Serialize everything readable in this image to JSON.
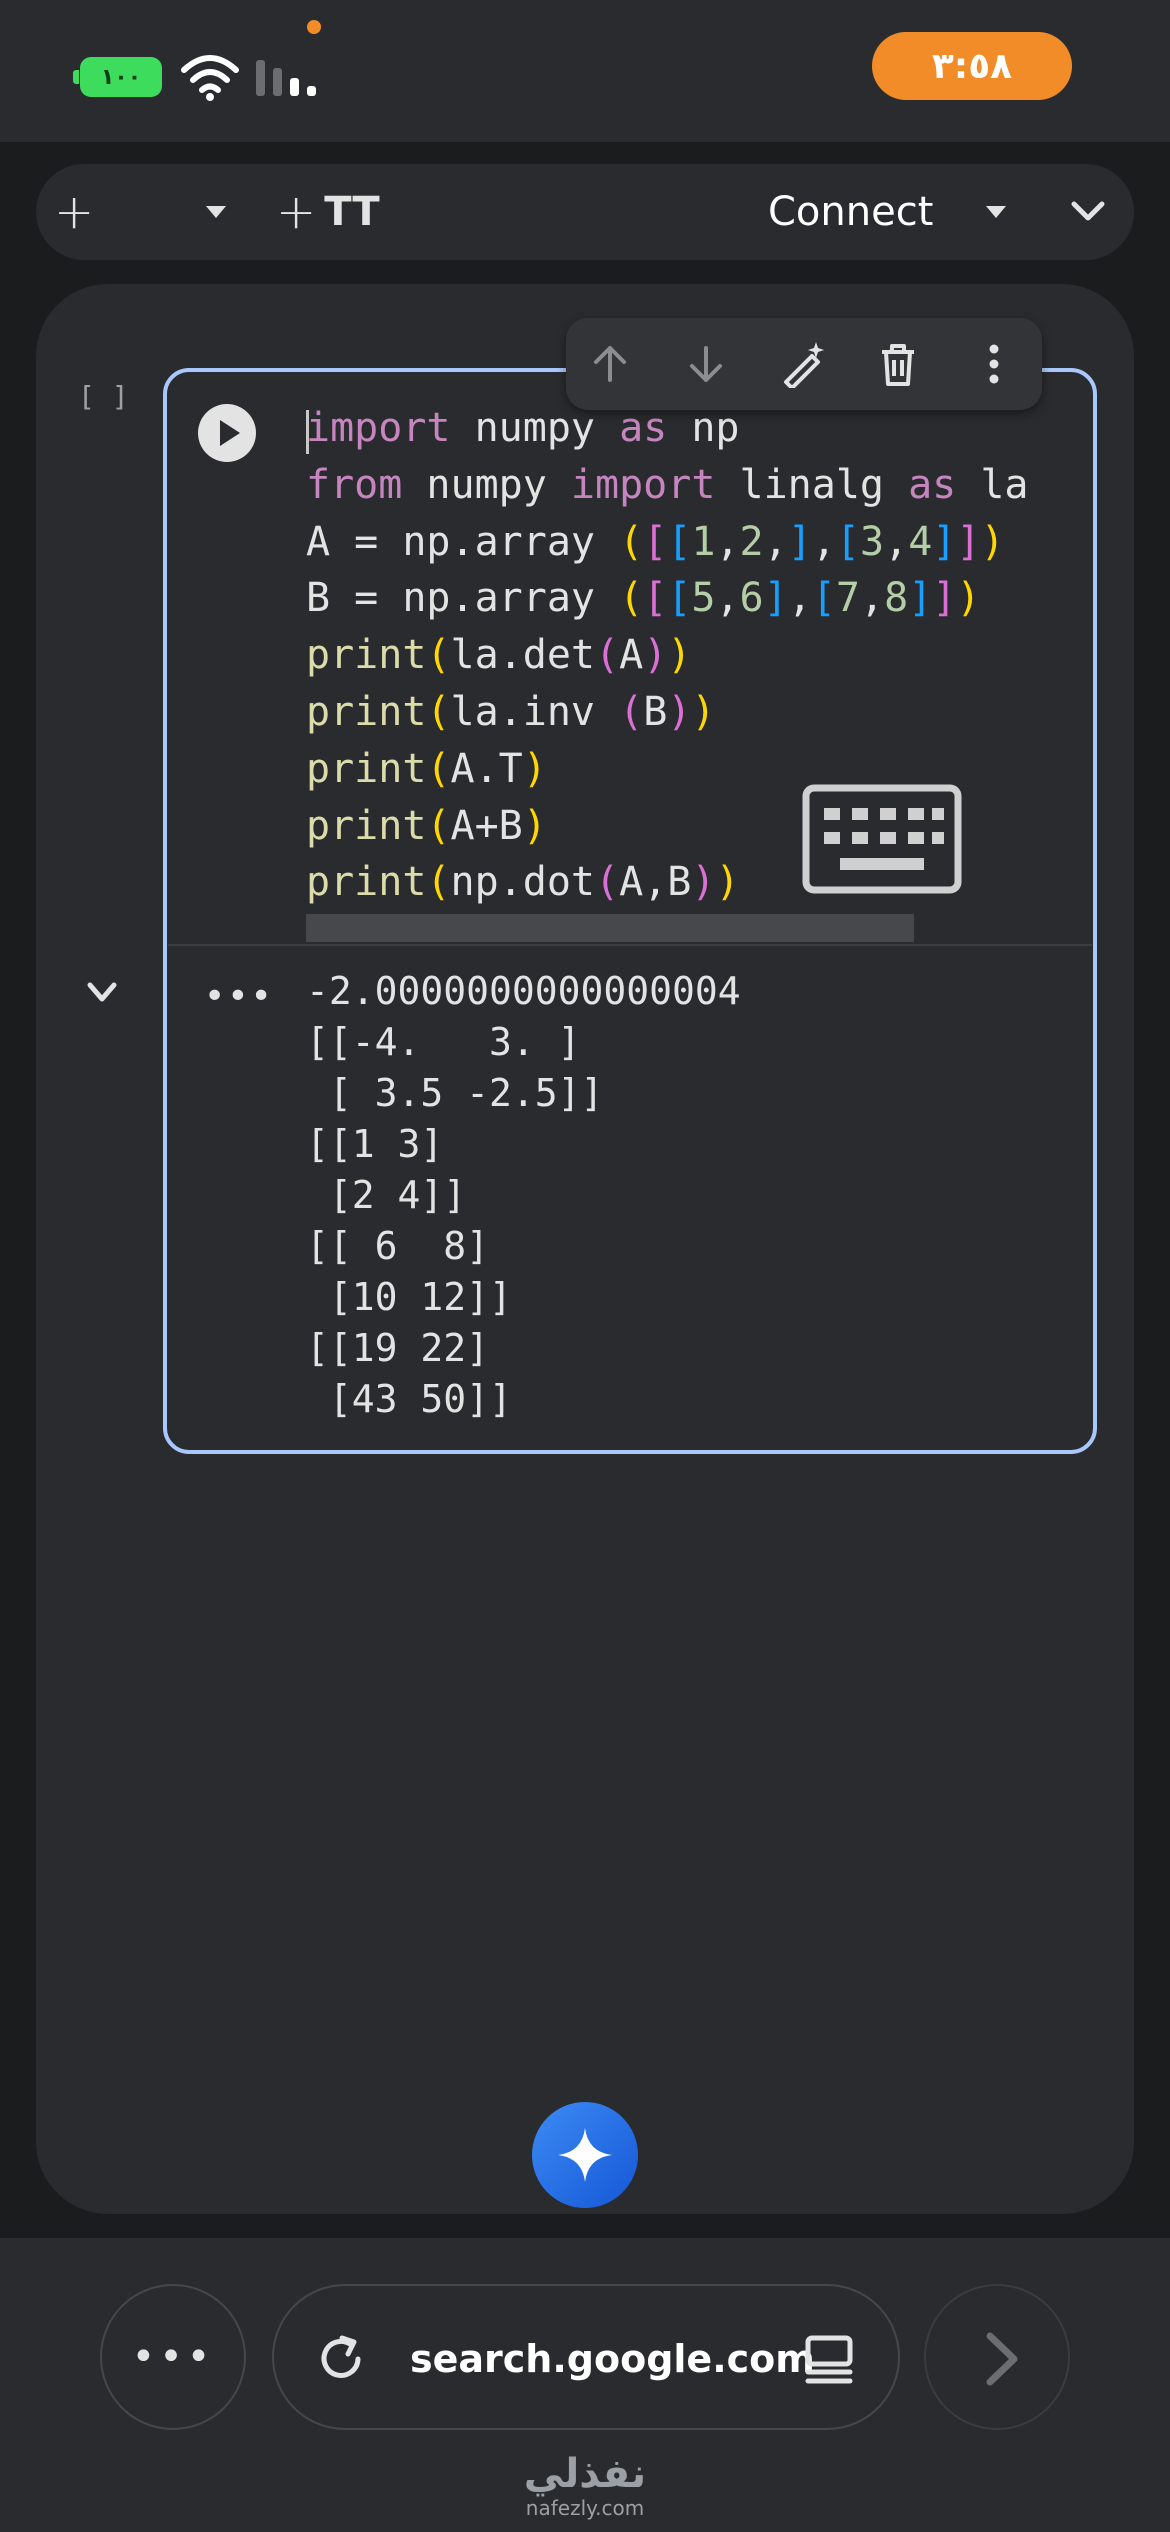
{
  "status_bar": {
    "battery": "١٠٠",
    "time": "٣:٥٨"
  },
  "toolbar": {
    "add_code_plus": "+",
    "add_code_label": "<>",
    "add_text_plus": "+",
    "add_text_label": "TT",
    "connect_label": "Connect"
  },
  "cell": {
    "execution_count": "[ ]",
    "code_lines": [
      [
        {
          "t": "import",
          "c": "kw"
        },
        {
          "t": " numpy ",
          "c": "tx"
        },
        {
          "t": "as",
          "c": "kw"
        },
        {
          "t": " np",
          "c": "tx"
        }
      ],
      [
        {
          "t": "from",
          "c": "kw"
        },
        {
          "t": " numpy ",
          "c": "tx"
        },
        {
          "t": "import",
          "c": "kw"
        },
        {
          "t": " linalg ",
          "c": "tx"
        },
        {
          "t": "as",
          "c": "kw"
        },
        {
          "t": " la",
          "c": "tx"
        }
      ],
      [
        {
          "t": "A = np.array ",
          "c": "tx"
        },
        {
          "t": "(",
          "c": "pn"
        },
        {
          "t": "[",
          "c": "pm"
        },
        {
          "t": "[",
          "c": "pb"
        },
        {
          "t": "1",
          "c": "nm"
        },
        {
          "t": ",",
          "c": "tx"
        },
        {
          "t": "2",
          "c": "nm"
        },
        {
          "t": ",",
          "c": "tx"
        },
        {
          "t": "]",
          "c": "pb"
        },
        {
          "t": ",",
          "c": "tx"
        },
        {
          "t": "[",
          "c": "pb"
        },
        {
          "t": "3",
          "c": "nm"
        },
        {
          "t": ",",
          "c": "tx"
        },
        {
          "t": "4",
          "c": "nm"
        },
        {
          "t": "]",
          "c": "pb"
        },
        {
          "t": "]",
          "c": "pm"
        },
        {
          "t": ")",
          "c": "pn"
        }
      ],
      [
        {
          "t": "B = np.array ",
          "c": "tx"
        },
        {
          "t": "(",
          "c": "pn"
        },
        {
          "t": "[",
          "c": "pm"
        },
        {
          "t": "[",
          "c": "pb"
        },
        {
          "t": "5",
          "c": "nm"
        },
        {
          "t": ",",
          "c": "tx"
        },
        {
          "t": "6",
          "c": "nm"
        },
        {
          "t": "]",
          "c": "pb"
        },
        {
          "t": ",",
          "c": "tx"
        },
        {
          "t": "[",
          "c": "pb"
        },
        {
          "t": "7",
          "c": "nm"
        },
        {
          "t": ",",
          "c": "tx"
        },
        {
          "t": "8",
          "c": "nm"
        },
        {
          "t": "]",
          "c": "pb"
        },
        {
          "t": "]",
          "c": "pm"
        },
        {
          "t": ")",
          "c": "pn"
        }
      ],
      [
        {
          "t": "print",
          "c": "fn"
        },
        {
          "t": "(",
          "c": "pn"
        },
        {
          "t": "la.det",
          "c": "tx"
        },
        {
          "t": "(",
          "c": "pm"
        },
        {
          "t": "A",
          "c": "tx"
        },
        {
          "t": ")",
          "c": "pm"
        },
        {
          "t": ")",
          "c": "pn"
        }
      ],
      [
        {
          "t": "print",
          "c": "fn"
        },
        {
          "t": "(",
          "c": "pn"
        },
        {
          "t": "la.inv ",
          "c": "tx"
        },
        {
          "t": "(",
          "c": "pm"
        },
        {
          "t": "B",
          "c": "tx"
        },
        {
          "t": ")",
          "c": "pm"
        },
        {
          "t": ")",
          "c": "pn"
        }
      ],
      [
        {
          "t": "print",
          "c": "fn"
        },
        {
          "t": "(",
          "c": "pn"
        },
        {
          "t": "A.T",
          "c": "tx"
        },
        {
          "t": ")",
          "c": "pn"
        }
      ],
      [
        {
          "t": "print",
          "c": "fn"
        },
        {
          "t": "(",
          "c": "pn"
        },
        {
          "t": "A+B",
          "c": "tx"
        },
        {
          "t": ")",
          "c": "pn"
        }
      ],
      [
        {
          "t": "print",
          "c": "fn"
        },
        {
          "t": "(",
          "c": "pn"
        },
        {
          "t": "np.dot",
          "c": "tx"
        },
        {
          "t": "(",
          "c": "pm"
        },
        {
          "t": "A,B",
          "c": "tx"
        },
        {
          "t": ")",
          "c": "pm"
        },
        {
          "t": ")",
          "c": "pn"
        }
      ]
    ],
    "output_more": "•••",
    "output_lines": [
      "-2.0000000000000004",
      "[[-4.   3. ]",
      " [ 3.5 -2.5]]",
      "[[1 3]",
      " [2 4]]",
      "[[ 6  8]",
      " [10 12]]",
      "[[19 22]",
      " [43 50]]"
    ]
  },
  "browser": {
    "more_label": "•••",
    "url": "search.google.com"
  },
  "watermark": {
    "arabic": "نفذلي",
    "domain": "nafezly.com"
  },
  "colors": {
    "accent_blue": "#a8c7fa",
    "battery_green": "#3ddc5c",
    "clock_orange": "#f28c28",
    "gemini_blue": "#1a73e8"
  }
}
